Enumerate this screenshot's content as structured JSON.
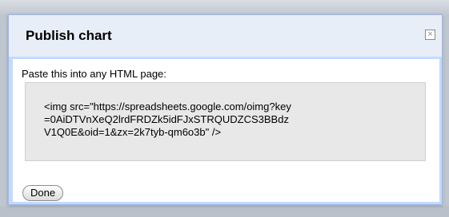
{
  "dialog": {
    "title": "Publish chart",
    "close_symbol": "×",
    "close_icon": "close-icon",
    "instruction": "Paste this into any HTML page:",
    "embed_code": "<img src=\"https://spreadsheets.google.com/oimg?key\n=0AiDTVnXeQ2lrdFRDZk5idFJxSTRQUDZCS3BBdz\nV1Q0E&oid=1&zx=2k7tyb-qm6o3b\" />",
    "done_label": "Done"
  },
  "colors": {
    "dialog_border": "#c3d9ff",
    "header_bg": "#e8eef7",
    "code_bg": "#e8e8e8"
  }
}
